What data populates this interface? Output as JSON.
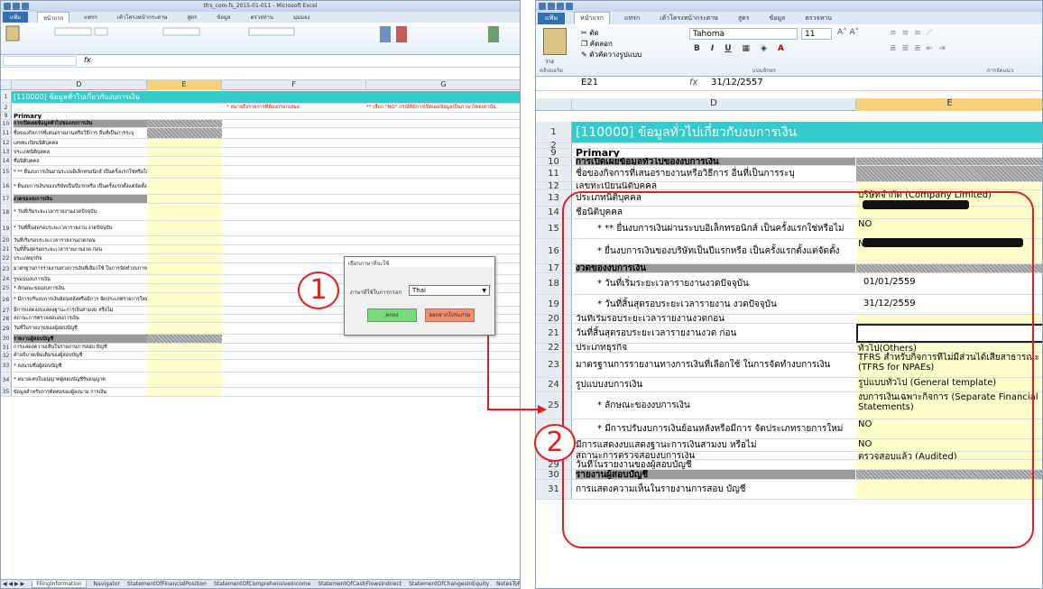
{
  "left_window": {
    "title": "tfrs_com-fs_2015-01-011 - Microsoft Excel",
    "tabs": [
      "แฟ้ม",
      "หน้าแรก",
      "แทรก",
      "เค้าโครงหน้ากระดาษ",
      "สูตร",
      "ข้อมูล",
      "ตรวจทาน",
      "มุมมอง"
    ],
    "name_box": "",
    "formula": "",
    "columns": [
      "D",
      "E",
      "F",
      "G"
    ],
    "header_title": "[110000] ข้อมูลทั่วไปเกี่ยวกับงบการเงิน",
    "note_f": "* หมายถึงรายการที่ต้องกรอกเสมอ",
    "note_g": "** เลือก \"NO\" กรณีที่มีการเปิดเผยข้อมูลเป็นภาษาไทยเท่านั้น",
    "rows": [
      {
        "n": "1",
        "d": "[110000] ข้อมูลทั่วไปเกี่ยวกับงบการเงิน"
      },
      {
        "n": "2",
        "d": ""
      },
      {
        "n": "9",
        "d": "Primary"
      },
      {
        "n": "10",
        "d": "การเปิดเผยข้อมูลทั่วไปของงบการเงิน"
      },
      {
        "n": "11",
        "d": "ชื่อของกิจการที่เสนอรายงานหรือวิธีการ อื่นที่เป็นการระบุ"
      },
      {
        "n": "12",
        "d": "เลขทะเบียนนิติบุคคล"
      },
      {
        "n": "13",
        "d": "ประเภทนิติบุคคล"
      },
      {
        "n": "14",
        "d": "ชื่อนิติบุคคล"
      },
      {
        "n": "15",
        "d": "* ** ยื่นงบการเงินผ่านระบบอิเล็กทรอนิกส์ เป็นครั้งแรกใช่หรือไม่"
      },
      {
        "n": "16",
        "d": "* ยื่นงบการเงินของบริษัทเป็นปีแรกหรือ เป็นครั้งแรกตั้งแต่จัดตั้งกิจการตาม กฎหมายใช่หรือไม่"
      },
      {
        "n": "17",
        "d": "งวดของงบการเงิน"
      },
      {
        "n": "18",
        "d": "* วันที่เริ่มระยะเวลารายงานงวดปัจจุบัน"
      },
      {
        "n": "19",
        "d": "* วันที่สิ้นสุดรอบระยะเวลารายงาน งวดปัจจุบัน"
      },
      {
        "n": "20",
        "d": "วันที่เริ่มรอบระยะเวลารายงานงวดก่อน"
      },
      {
        "n": "21",
        "d": "วันที่สิ้นสุดรอบระยะเวลารายงานงวด ก่อน"
      },
      {
        "n": "22",
        "d": "ประเภทธุรกิจ"
      },
      {
        "n": "23",
        "d": "มาตรฐานการรายงานทางการเงินที่เลือกใช้ ในการจัดทำงบการเงิน"
      },
      {
        "n": "24",
        "d": "รูปแบบงบการเงิน"
      },
      {
        "n": "25",
        "d": "* ลักษณะของงบการเงิน"
      },
      {
        "n": "26",
        "d": "* มีการปรับงบการเงินย้อนหลังหรือมีการ จัดประเภทรายการใหม่หรือไม่"
      },
      {
        "n": "27",
        "d": "มีการแสดงงบแสดงฐานะการเงินสามงบ หรือไม่"
      },
      {
        "n": "28",
        "d": "สถานะการตรวจสอบงบการเงิน"
      },
      {
        "n": "29",
        "d": "วันที่ในรายงานของผู้สอบบัญชี"
      },
      {
        "n": "30",
        "d": "รายงานผู้สอบบัญชี"
      },
      {
        "n": "31",
        "d": "การแสดงความเห็นในรายงานการสอบ บัญชี"
      },
      {
        "n": "32",
        "d": "คำอธิบายเพิ่มเติมของผู้สอบบัญชี"
      },
      {
        "n": "33",
        "d": "* ลงนามชื่อผู้สอบบัญชี"
      },
      {
        "n": "34",
        "d": "* หมายเลขใบอนุญาตผู้สอบบัญชีรับอนุญาต"
      },
      {
        "n": "35",
        "d": "ข้อมูลสำหรับการติดต่อของผู้ลงนาม การเงิน"
      }
    ],
    "sheet_tabs": [
      "FilingInformation",
      "Navigator",
      "StatementOfFinancialPosition",
      "StatementOfComprehensiveIncome",
      "StatementOfCashFlowsIndirect",
      "StatementOfChangesInEquity",
      "NotesToFinancialStatement"
    ],
    "dialog": {
      "title": "เลือกภาษาที่จะใช้",
      "label": "ภาษาที่ใช้ในการกรอก",
      "selected": "Thai",
      "ok": "ตกลง",
      "cancel": "ออกจากโปรแกรม"
    }
  },
  "right_window": {
    "tabs": [
      "แฟ้ม",
      "หน้าแรก",
      "แทรก",
      "เค้าโครงหน้ากระดาษ",
      "สูตร",
      "ข้อมูล",
      "ตรวจทาน"
    ],
    "font_name": "Tahoma",
    "font_size": "11",
    "clipboard_labels": [
      "ตัด",
      "คัดลอก",
      "ตัวคัดวางรูปแบบ"
    ],
    "group_labels": [
      "คลิปบอร์ด",
      "แบบอักษร",
      "การจัดแนว"
    ],
    "paste_label": "วาง",
    "name_box": "E21",
    "formula": "31/12/2557",
    "columns": [
      "D",
      "E"
    ],
    "rows": [
      {
        "n": "1",
        "d": "[110000] ข้อมูลทั่วไปเกี่ยวกับงบการเงิน",
        "e": ""
      },
      {
        "n": "2",
        "d": "",
        "e": ""
      },
      {
        "n": "9",
        "d": "Primary",
        "e": ""
      },
      {
        "n": "10",
        "d": "การเปิดเผยข้อมูลทั่วไปของงบการเงิน",
        "e": ""
      },
      {
        "n": "11",
        "d": "ชื่อของกิจการที่เสนอรายงานหรือวิธีการ อื่นที่เป็นการระบุ",
        "e": ""
      },
      {
        "n": "12",
        "d": "เลขทะเบียนนิติบุคคล",
        "e": ""
      },
      {
        "n": "13",
        "d": "ประเภทนิติบุคคล",
        "e": "บริษัทจำกัด (Company Limited)"
      },
      {
        "n": "14",
        "d": "ชื่อนิติบุคคล",
        "e": ""
      },
      {
        "n": "15",
        "d": "* ** ยื่นงบการเงินผ่านระบบอิเล็กทรอนิกส์ เป็นครั้งแรกใช่หรือไม่",
        "e": "NO"
      },
      {
        "n": "16",
        "d": "* ยื่นงบการเงินของบริษัทเป็นปีแรกหรือ เป็นครั้งแรกตั้งแต่จัดตั้งกิจการตาม กฎหมายใช่หรือไม่",
        "e": "NO"
      },
      {
        "n": "17",
        "d": "งวดของงบการเงิน",
        "e": ""
      },
      {
        "n": "18",
        "d": "* วันที่เริ่มระยะเวลารายงานงวดปัจจุบัน",
        "e": "01/01/2559"
      },
      {
        "n": "19",
        "d": "* วันที่สิ้นสุดรอบระยะเวลารายงาน งวดปัจจุบัน",
        "e": "31/12/2559"
      },
      {
        "n": "20",
        "d": "วันที่เริ่มรอบระยะเวลารายงานงวดก่อน",
        "e": ""
      },
      {
        "n": "21",
        "d": "วันที่สิ้นสุดรอบระยะเวลารายงานงวด ก่อน",
        "e": ""
      },
      {
        "n": "22",
        "d": "ประเภทธุรกิจ",
        "e": "ทั่วไป(Others)"
      },
      {
        "n": "23",
        "d": "มาตรฐานการรายงานทางการเงินที่เลือกใช้ ในการจัดทำงบการเงิน",
        "e": "TFRS สำหรับกิจการที่ไม่มีส่วนได้เสียสาธารณะ (TFRS for NPAEs)"
      },
      {
        "n": "24",
        "d": "รูปแบบงบการเงิน",
        "e": "รูปแบบทั่วไป (General template)"
      },
      {
        "n": "25",
        "d": "* ลักษณะของงบการเงิน",
        "e": "งบการเงินเฉพาะกิจการ (Separate Financial Statements)"
      },
      {
        "n": "26",
        "d": "* มีการปรับงบการเงินย้อนหลังหรือมีการ จัดประเภทรายการใหม่หรือไม่",
        "e": "NO"
      },
      {
        "n": "27",
        "d": "มีการแสดงงบแสดงฐานะการเงินสามงบ หรือไม่",
        "e": "NO"
      },
      {
        "n": "28",
        "d": "สถานะการตรวจสอบงบการเงิน",
        "e": "ตรวจสอบแล้ว (Audited)"
      },
      {
        "n": "29",
        "d": "วันที่ในรายงานของผู้สอบบัญชี",
        "e": ""
      },
      {
        "n": "30",
        "d": "รายงานผู้สอบบัญชี",
        "e": ""
      },
      {
        "n": "31",
        "d": "การแสดงความเห็นในรายงานการสอบ บัญชี",
        "e": ""
      }
    ]
  },
  "callouts": {
    "one": "1",
    "two": "2"
  },
  "colors": {
    "accent_red": "#e02020",
    "header_teal": "#33cccc",
    "input_yellow": "#ffffcc"
  }
}
